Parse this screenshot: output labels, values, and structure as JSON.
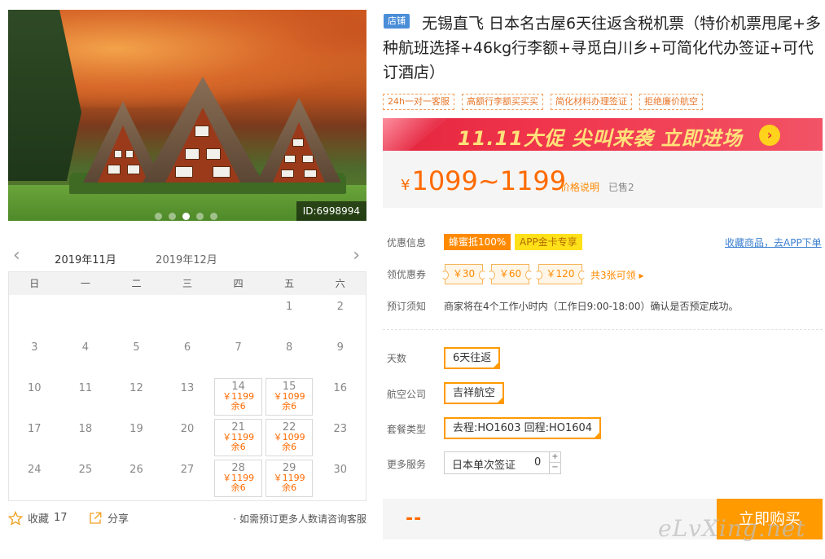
{
  "photo": {
    "id_label": "ID:6998994",
    "carousel_dots": 5,
    "active_dot": 3
  },
  "calendar": {
    "months": [
      "2019年11月",
      "2019年12月"
    ],
    "active_month": 0,
    "weekdays": [
      "日",
      "一",
      "二",
      "三",
      "四",
      "五",
      "六"
    ],
    "rows": [
      [
        {
          "d": ""
        },
        {
          "d": ""
        },
        {
          "d": ""
        },
        {
          "d": ""
        },
        {
          "d": ""
        },
        {
          "d": "1"
        },
        {
          "d": "2"
        }
      ],
      [
        {
          "d": "3"
        },
        {
          "d": "4"
        },
        {
          "d": "5"
        },
        {
          "d": "6"
        },
        {
          "d": "7"
        },
        {
          "d": "8"
        },
        {
          "d": "9"
        }
      ],
      [
        {
          "d": "10"
        },
        {
          "d": "11"
        },
        {
          "d": "12"
        },
        {
          "d": "13"
        },
        {
          "d": "14",
          "price": "￥1199",
          "stock": "余6"
        },
        {
          "d": "15",
          "price": "￥1099",
          "stock": "余6"
        },
        {
          "d": "16"
        }
      ],
      [
        {
          "d": "17"
        },
        {
          "d": "18"
        },
        {
          "d": "19"
        },
        {
          "d": "20"
        },
        {
          "d": "21",
          "price": "￥1199",
          "stock": "余6"
        },
        {
          "d": "22",
          "price": "￥1099",
          "stock": "余6"
        },
        {
          "d": "23"
        }
      ],
      [
        {
          "d": "24"
        },
        {
          "d": "25"
        },
        {
          "d": "26"
        },
        {
          "d": "27"
        },
        {
          "d": "28",
          "price": "￥1199",
          "stock": "余6"
        },
        {
          "d": "29",
          "price": "￥1199",
          "stock": "余6"
        },
        {
          "d": "30"
        }
      ]
    ],
    "footer": {
      "favorite_label": "收藏",
      "favorite_count": "17",
      "share_label": "分享",
      "note": "· 如需预订更多人数请咨询客服"
    }
  },
  "product": {
    "shop_tag": "店铺",
    "title": "无锡直飞 日本名古屋6天往返含税机票（特价机票甩尾+多种航班选择+46kg行李额+寻觅白川乡+可简化代办签证+可代订酒店）",
    "badges": [
      "24h一对一客服",
      "高额行李额买买买",
      "简化材料办理签证",
      "拒绝廉价航空"
    ],
    "promo_text": "11.11大促 尖叫来袭  立即进场",
    "price_currency": "¥",
    "price_range": "1099~1199",
    "price_explain": "价格说明",
    "sold": "已售2"
  },
  "info": {
    "discount_label": "优惠信息",
    "discount_tags": [
      "蜂蜜抵100%",
      "APP金卡专享"
    ],
    "app_link": "收藏商品，去APP下单",
    "coupon_label": "领优惠券",
    "coupons": [
      "￥30",
      "￥60",
      "￥120"
    ],
    "coupon_more": "共3张可领 ▸",
    "notice_label": "预订须知",
    "notice_text": "商家将在4个工作小时内（工作日9:00-18:00）确认是否预定成功。"
  },
  "options": {
    "days_label": "天数",
    "days_value": "6天往返",
    "airline_label": "航空公司",
    "airline_value": "吉祥航空",
    "package_label": "套餐类型",
    "package_value": "去程:HO1603 回程:HO1604",
    "service_label": "更多服务",
    "service_value": "日本单次签证",
    "service_qty": "0"
  },
  "buy": {
    "total": "--",
    "button": "立即购买"
  },
  "watermark": "eLvXing.net",
  "colors": {
    "accent": "#ff9a00",
    "price": "#ff6a00",
    "promo_red": "#e3263e",
    "shop_tag_blue": "#4a8ed8"
  }
}
